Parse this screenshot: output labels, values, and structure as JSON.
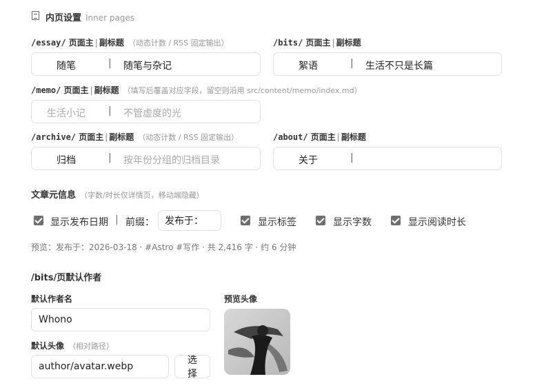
{
  "header": {
    "title": "内页设置",
    "subtitle": "Inner pages"
  },
  "essay": {
    "path": "/essay/",
    "label": "页面主",
    "sep": "|",
    "label2": "副标题",
    "hint": "（动态计数 / RSS 固定输出）",
    "main": "随笔",
    "bar": "|",
    "sub": "随笔与杂记"
  },
  "bits": {
    "path": "/bits/",
    "label": "页面主",
    "sep": "|",
    "label2": "副标题",
    "main": "絮语",
    "bar": "|",
    "sub": "生活不只是长篇"
  },
  "memo": {
    "path": "/memo/",
    "label": "页面主",
    "sep": "|",
    "label2": "副标题",
    "hint": "（填写后覆盖对应字段，留空则沿用 src/content/memo/index.md）",
    "main_placeholder": "生活小记",
    "bar": "|",
    "sub_placeholder": "不管虚度的光"
  },
  "archive": {
    "path": "/archive/",
    "label": "页面主",
    "sep": "|",
    "label2": "副标题",
    "hint": "（动态计数 / RSS 固定输出）",
    "main": "归档",
    "bar": "|",
    "sub_placeholder": "按年份分组的归档目录"
  },
  "about": {
    "path": "/about/",
    "label": "页面主",
    "sep": "|",
    "label2": "副标题",
    "main": "关于",
    "bar": "|"
  },
  "meta": {
    "title": "文章元信息",
    "hint": "（字数/时长仅详情页，移动端隐藏）",
    "show_date": "显示发布日期",
    "sep": "|",
    "prefix_label": "前缀：",
    "prefix_value": "发布于：",
    "show_tags": "显示标签",
    "show_words": "显示字数",
    "show_reading": "显示阅读时长",
    "preview": "预览：发布于：2026-03-18 · #Astro  #写作 · 共 2,416 字 · 约 6 分钟"
  },
  "author": {
    "title": "/bits/页默认作者",
    "name_label": "默认作者名",
    "name_value": "Whono",
    "avatar_label": "默认头像",
    "avatar_hint": "（相对路径）",
    "avatar_value": "author/avatar.webp",
    "choose_button": "选择",
    "preview_label": "预览头像"
  }
}
